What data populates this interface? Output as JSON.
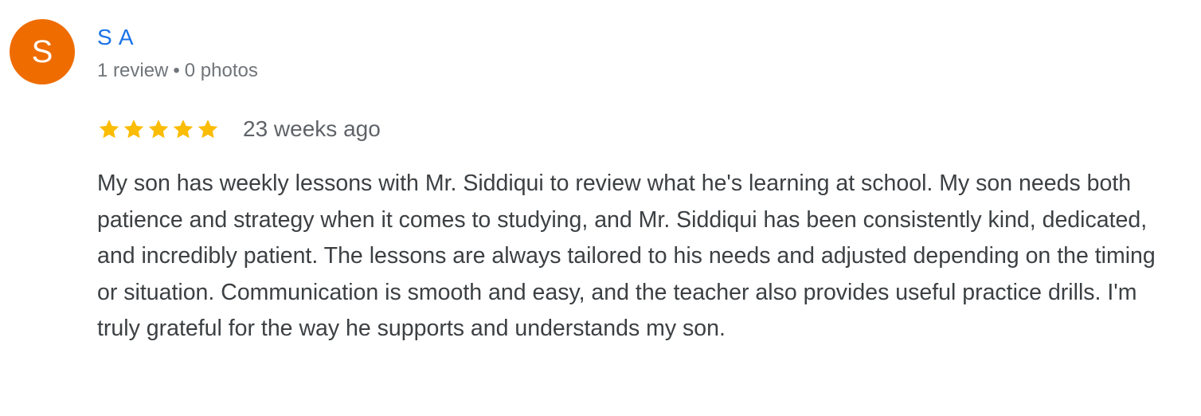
{
  "reviewer": {
    "initial": "S",
    "name": "S A",
    "review_count": "1 review",
    "separator": "•",
    "photo_count": "0 photos",
    "avatar_color": "#ef6c00"
  },
  "review": {
    "rating": 5,
    "rating_max": 5,
    "star_color": "#fbbc04",
    "date": "23 weeks ago",
    "text": "My son has weekly lessons with Mr. Siddiqui to review what he's learning at school. My son needs both patience and strategy when it comes to studying, and Mr. Siddiqui has been consistently kind, dedicated, and incredibly patient. The lessons are always tailored to his needs and adjusted depending on the timing or situation. Communication is smooth and easy, and the teacher also provides useful practice drills. I'm truly grateful for the way he supports and understands my son."
  },
  "colors": {
    "name_link": "#1a73e8",
    "meta_text": "#70757a",
    "body_text": "#3c4043"
  }
}
